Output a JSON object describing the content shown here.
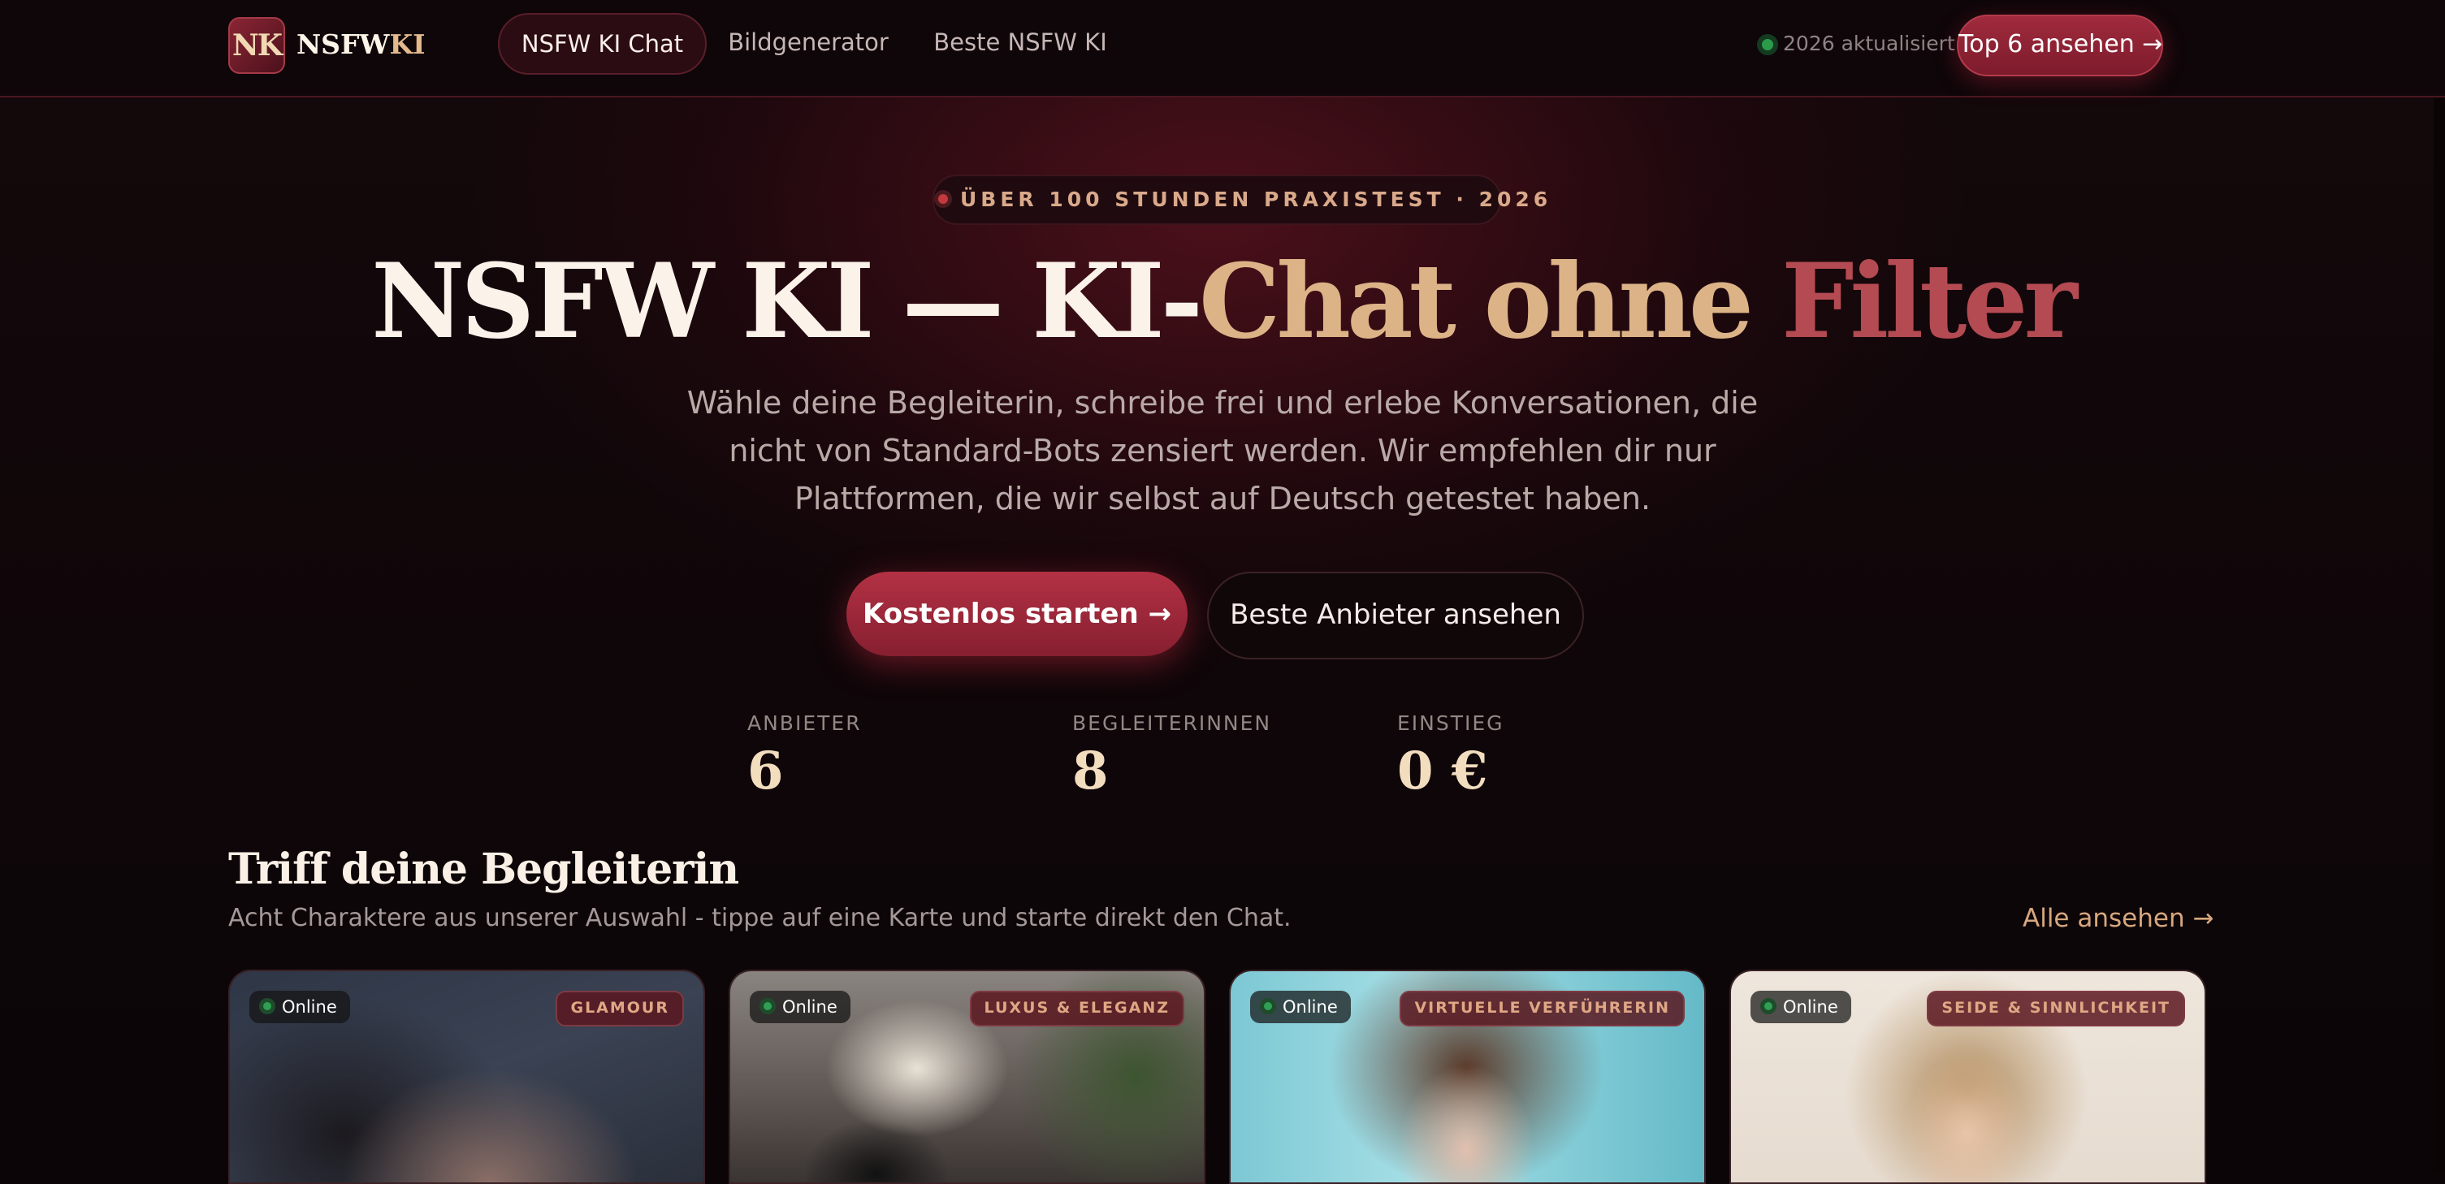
{
  "nav": {
    "logo_mark": "NK",
    "logo_text_main": "NSFW",
    "logo_text_accent": "KI",
    "items": [
      {
        "label": "NSFW KI Chat",
        "active": true
      },
      {
        "label": "Bildgenerator",
        "active": false
      },
      {
        "label": "Beste NSFW KI",
        "active": false
      }
    ],
    "status": "2026 aktualisiert",
    "cta": "Top 6 ansehen →"
  },
  "hero": {
    "pill": "ÜBER 100 STUNDEN PRAXISTEST · 2026",
    "title_part1": "NSFW KI — KI-",
    "title_part2": "Chat ohne ",
    "title_part3": "Filter",
    "subtitle": "Wähle deine Begleiterin, schreibe frei und erlebe Konversationen, die nicht von Standard-Bots zensiert werden. Wir empfehlen dir nur Plattformen, die wir selbst auf Deutsch getestet haben.",
    "primary_button": "Kostenlos starten →",
    "secondary_button": "Beste Anbieter ansehen",
    "stats": [
      {
        "label": "ANBIETER",
        "value": "6"
      },
      {
        "label": "BEGLEITERINNEN",
        "value": "8"
      },
      {
        "label": "EINSTIEG",
        "value": "0 €"
      }
    ]
  },
  "section": {
    "title": "Triff deine Begleiterin",
    "subtitle": "Acht Charaktere aus unserer Auswahl - tippe auf eine Karte und starte direkt den Chat.",
    "see_all": "Alle ansehen →"
  },
  "cards": [
    {
      "status": "Online",
      "category": "GLAMOUR"
    },
    {
      "status": "Online",
      "category": "LUXUS & ELEGANZ"
    },
    {
      "status": "Online",
      "category": "VIRTUELLE VERFÜHRERIN"
    },
    {
      "status": "Online",
      "category": "SEIDE & SINNLICHKEIT"
    }
  ],
  "colors": {
    "background": "#0b0507",
    "accent": "#a02b3d",
    "gold": "#dcb387",
    "online": "#2f9f53"
  }
}
